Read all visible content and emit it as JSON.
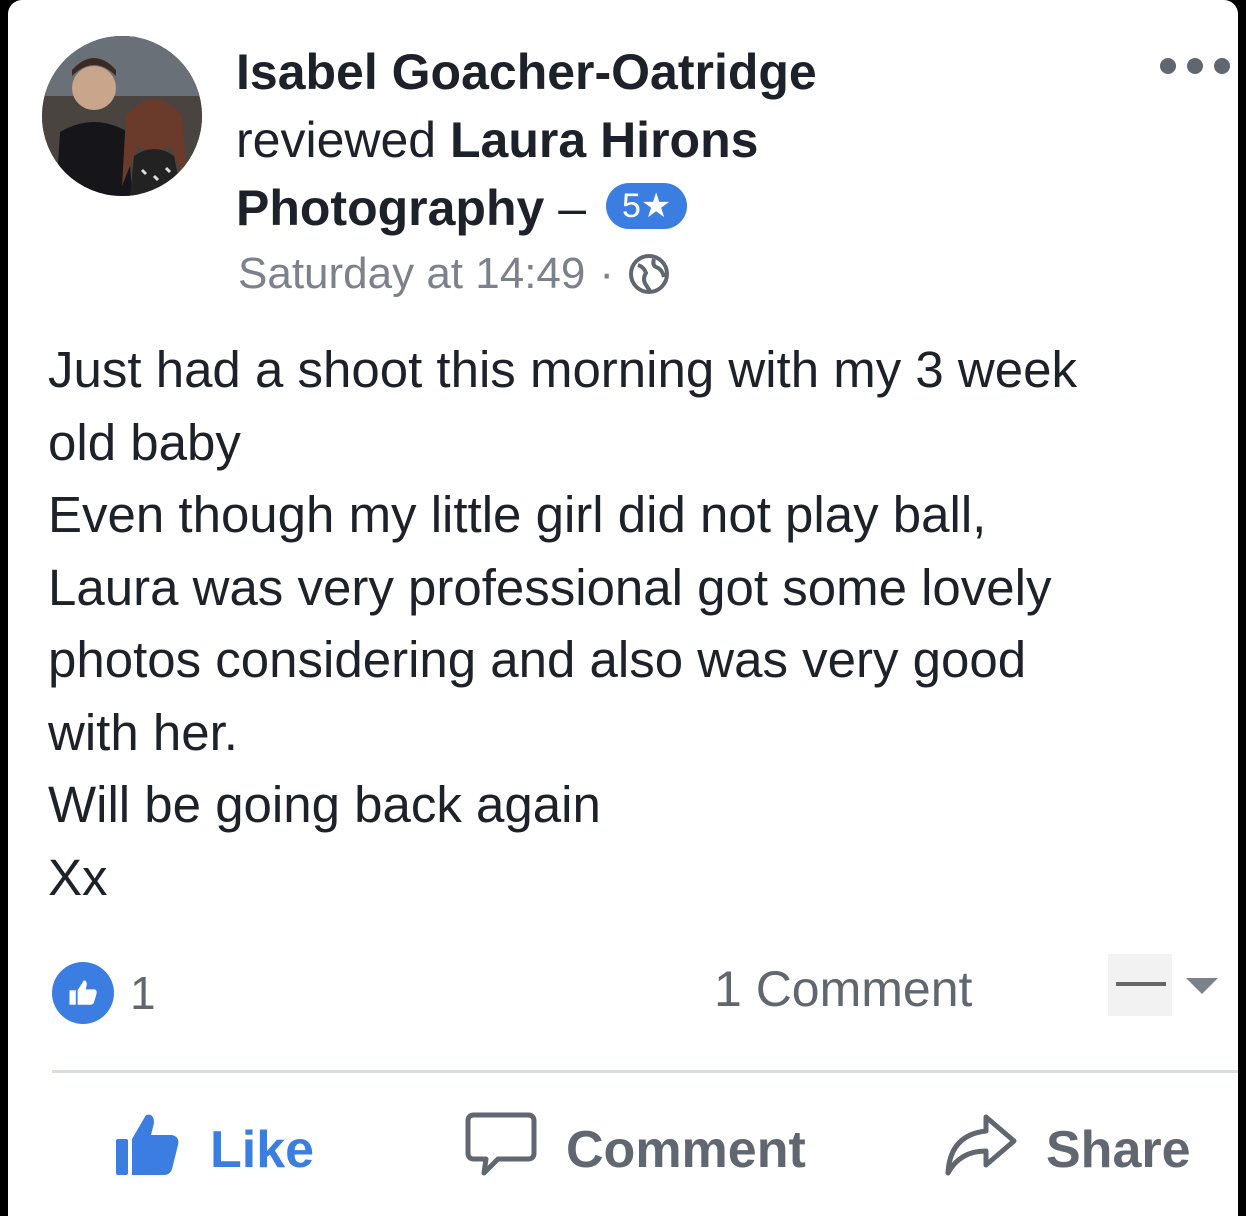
{
  "post": {
    "author_name": "Isabel Goacher-Oatridge",
    "verb": "reviewed",
    "page_name_line1": "Laura Hirons",
    "page_name_line2": "Photography",
    "separator": "–",
    "rating": "5★",
    "timestamp": "Saturday at 14:49",
    "meta_dot": "·",
    "privacy_icon": "globe-icon",
    "more_icon": "more-options-icon",
    "body_lines": [
      "Just had a shoot this morning with my 3 week",
      "old baby",
      "Even though my little girl did not play ball,",
      "Laura was very professional got some lovely",
      "photos considering and also was very good",
      "with her.",
      "Will be going back again",
      "Xx"
    ]
  },
  "engagement": {
    "like_count": "1",
    "comment_count": "1 Comment"
  },
  "actions": {
    "like_label": "Like",
    "comment_label": "Comment",
    "share_label": "Share"
  },
  "colors": {
    "accent": "#3b7de0",
    "text": "#1d2129",
    "muted": "#606770"
  }
}
